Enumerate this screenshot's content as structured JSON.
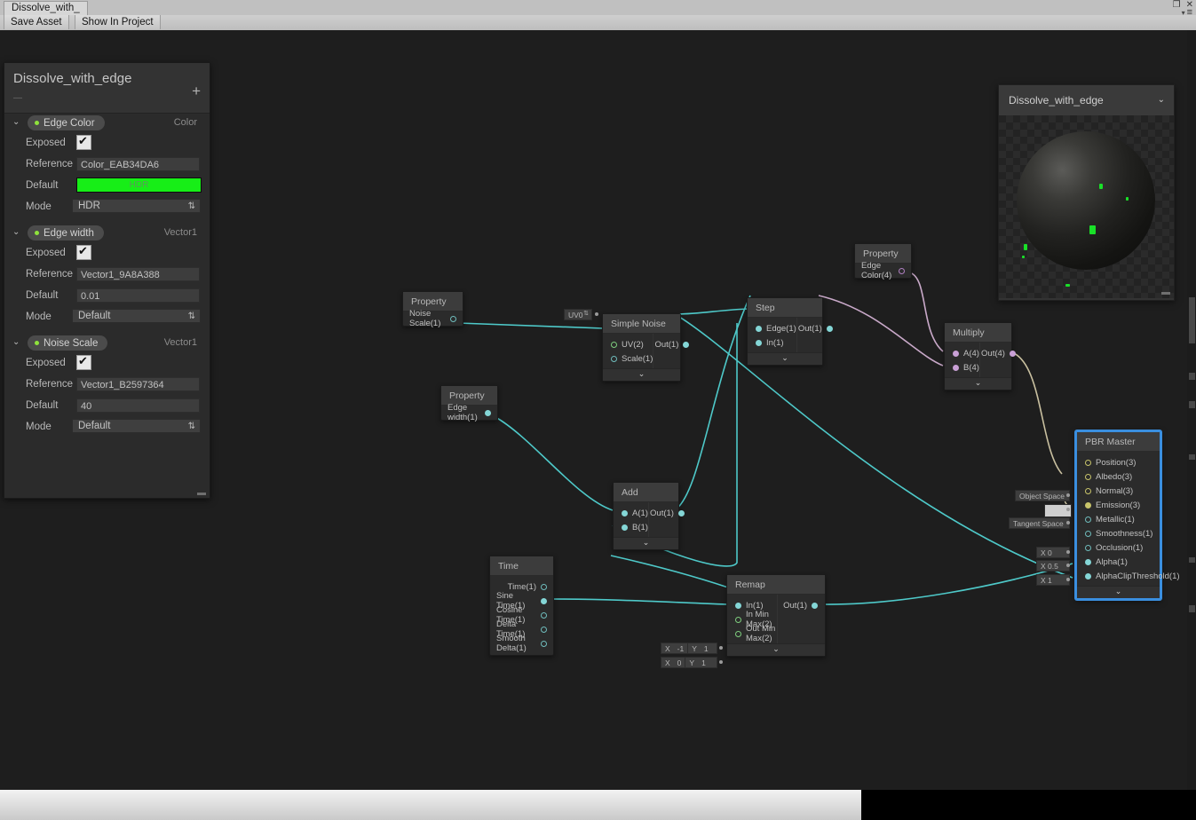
{
  "window": {
    "doc_tab": "Dissolve_with_",
    "toolbar": {
      "save": "Save Asset",
      "show": "Show In Project"
    },
    "controls": {
      "restore": "❐",
      "close": "✕",
      "menu": "≡",
      "menu_caret": "▾"
    }
  },
  "blackboard": {
    "title": "Dissolve_with_edge",
    "subtitle": "—",
    "add_label": "+",
    "arrow": "⌄",
    "properties": [
      {
        "name": "Edge Color",
        "type": "Color",
        "exposed_label": "Exposed",
        "exposed": true,
        "reference_label": "Reference",
        "reference": "Color_EAB34DA6",
        "default_label": "Default",
        "default_value": "HDR",
        "default_color": "#17ee17",
        "mode_label": "Mode",
        "mode": "HDR"
      },
      {
        "name": "Edge width",
        "type": "Vector1",
        "exposed_label": "Exposed",
        "exposed": true,
        "reference_label": "Reference",
        "reference": "Vector1_9A8A388",
        "default_label": "Default",
        "default_value": "0.01",
        "mode_label": "Mode",
        "mode": "Default"
      },
      {
        "name": "Noise Scale",
        "type": "Vector1",
        "exposed_label": "Exposed",
        "exposed": true,
        "reference_label": "Reference",
        "reference": "Vector1_B2597364",
        "default_label": "Default",
        "default_value": "40",
        "mode_label": "Mode",
        "mode": "Default"
      }
    ]
  },
  "preview": {
    "name": "Dissolve_with_edge",
    "caret": "⌄",
    "specks_color": "#19e028"
  },
  "nodes": {
    "property_noise_scale": {
      "title": "Property",
      "out_port": "Noise Scale(1)"
    },
    "simple_noise": {
      "title": "Simple Noise",
      "inputs": [
        "UV(2)",
        "Scale(1)"
      ],
      "output": "Out(1)",
      "uv_widget": "UV0",
      "foot": "⌄"
    },
    "step": {
      "title": "Step",
      "inputs": [
        "Edge(1)",
        "In(1)"
      ],
      "output": "Out(1)",
      "foot": "⌄"
    },
    "property_edge_color": {
      "title": "Property",
      "out_port": "Edge Color(4)"
    },
    "multiply": {
      "title": "Multiply",
      "inputs": [
        "A(4)",
        "B(4)"
      ],
      "output": "Out(4)",
      "foot": "⌄"
    },
    "property_edge_width": {
      "title": "Property",
      "out_port": "Edge width(1)"
    },
    "add": {
      "title": "Add",
      "inputs": [
        "A(1)",
        "B(1)"
      ],
      "output": "Out(1)",
      "foot": "⌄"
    },
    "time": {
      "title": "Time",
      "outputs": [
        "Time(1)",
        "Sine Time(1)",
        "Cosine Time(1)",
        "Delta Time(1)",
        "Smooth Delta(1)"
      ]
    },
    "remap": {
      "title": "Remap",
      "inputs": [
        "In(1)",
        "In Min Max(2)",
        "Out Min Max(2)"
      ],
      "output": "Out(1)",
      "in_min_max": {
        "x_label": "X",
        "x": "-1",
        "y_label": "Y",
        "y": "1"
      },
      "out_min_max": {
        "x_label": "X",
        "x": "0",
        "y_label": "Y",
        "y": "1"
      },
      "foot": "⌄"
    },
    "pbr_master": {
      "title": "PBR Master",
      "selected": true,
      "foot": "⌄",
      "slots": [
        {
          "label": "Position(3)",
          "widget": "Object Space"
        },
        {
          "label": "Albedo(3)",
          "widget": "__color__"
        },
        {
          "label": "Normal(3)",
          "widget": "Tangent Space"
        },
        {
          "label": "Emission(3)",
          "widget": ""
        },
        {
          "label": "Metallic(1)",
          "widget": "X 0"
        },
        {
          "label": "Smoothness(1)",
          "widget": "X 0.5"
        },
        {
          "label": "Occlusion(1)",
          "widget": "X 1"
        },
        {
          "label": "Alpha(1)",
          "widget": ""
        },
        {
          "label": "AlphaClipThreshold(1)",
          "widget": ""
        }
      ]
    }
  },
  "colors": {
    "wire_float": "#4ec9c9",
    "wire_vector4": "#c9a9c9",
    "wire_yellow": "#c8c46a",
    "canvas_bg": "#1e1e1e",
    "node_bg": "#2b2b2b",
    "selection": "#3a8fe0"
  }
}
